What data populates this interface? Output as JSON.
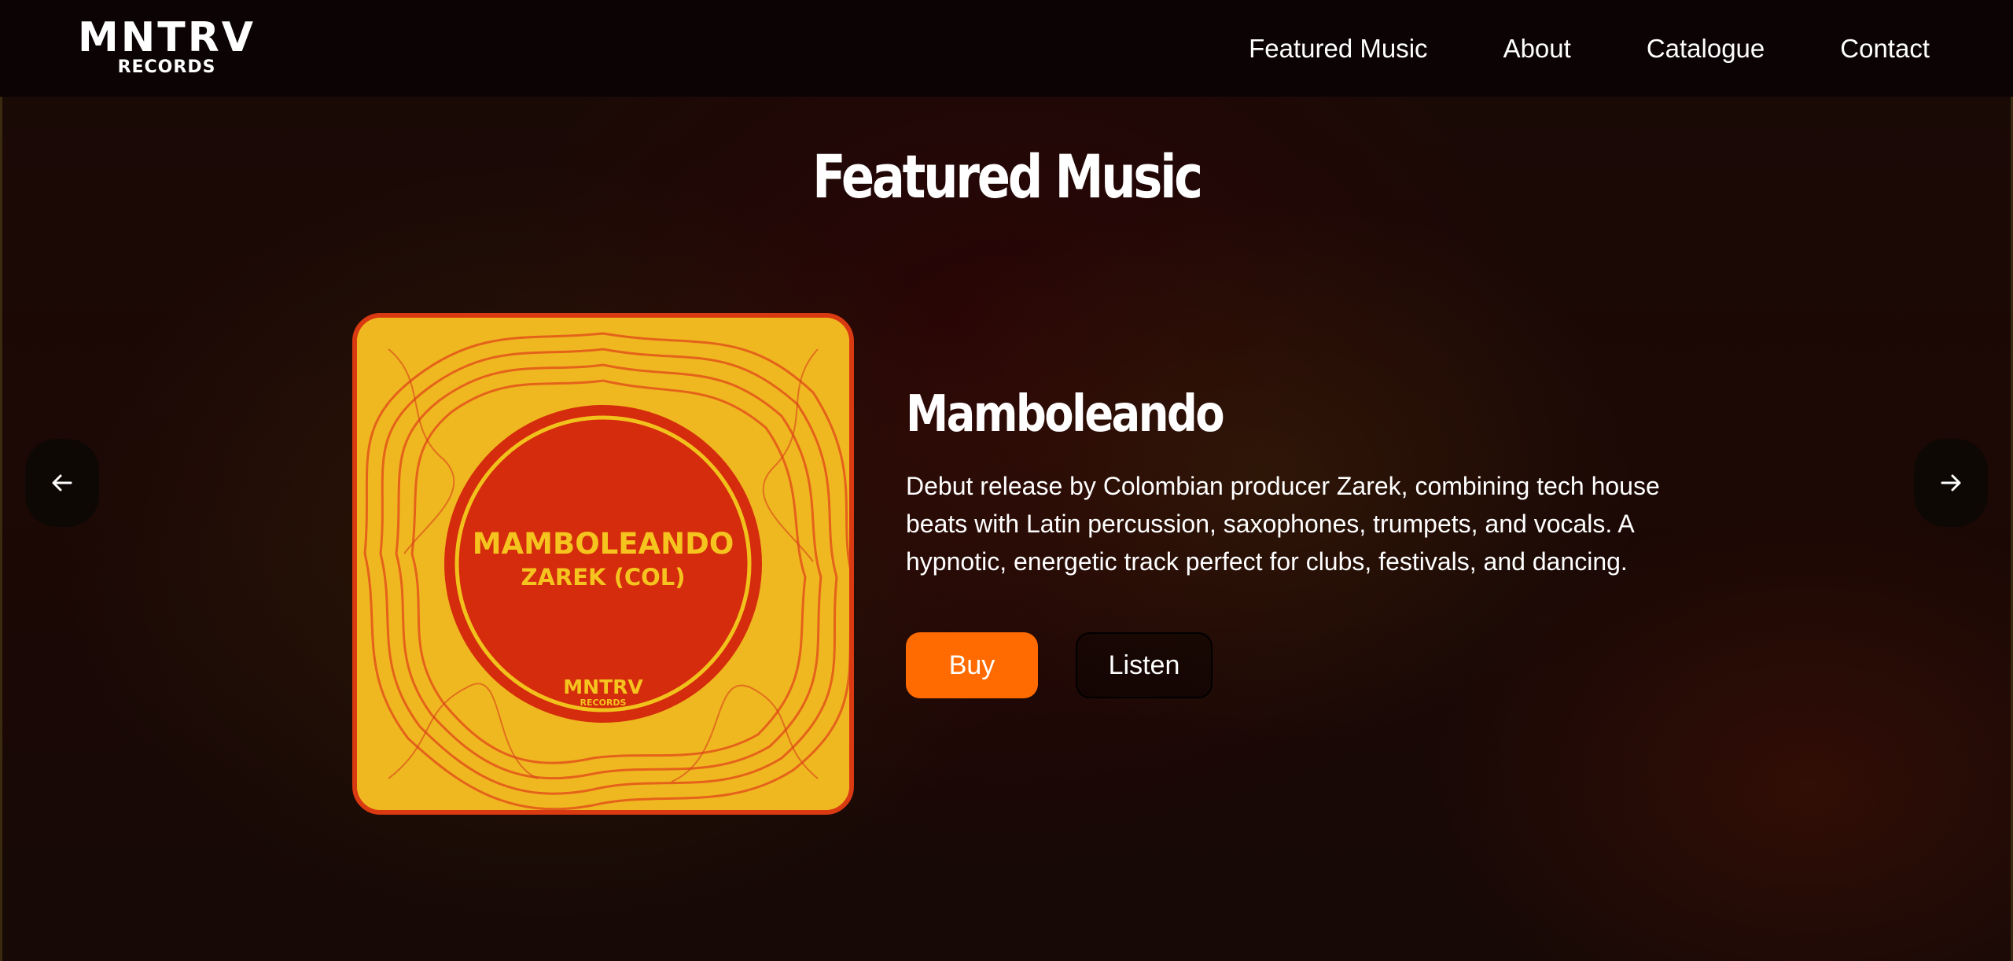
{
  "header": {
    "logo_main": "MNTRV",
    "logo_sub": "RECORDS",
    "nav": [
      "Featured Music",
      "About",
      "Catalogue",
      "Contact"
    ]
  },
  "section": {
    "title": "Featured Music"
  },
  "carousel": {
    "prev_icon": "arrow-left-icon",
    "next_icon": "arrow-right-icon"
  },
  "release": {
    "title": "Mamboleando",
    "description": "Debut release by Colombian producer Zarek, combining tech house beats with Latin percussion, saxophones, trumpets, and vocals. A hypnotic, energetic track perfect for clubs, festivals, and dancing.",
    "buy_label": "Buy",
    "listen_label": "Listen",
    "cover": {
      "title": "MAMBOLEANDO",
      "artist": "ZAREK (COL)",
      "label_main": "MNTRV",
      "label_sub": "RECORDS"
    }
  },
  "colors": {
    "accent": "#ff6b00",
    "cover_yellow": "#f0b820",
    "cover_red": "#d42c0c"
  }
}
